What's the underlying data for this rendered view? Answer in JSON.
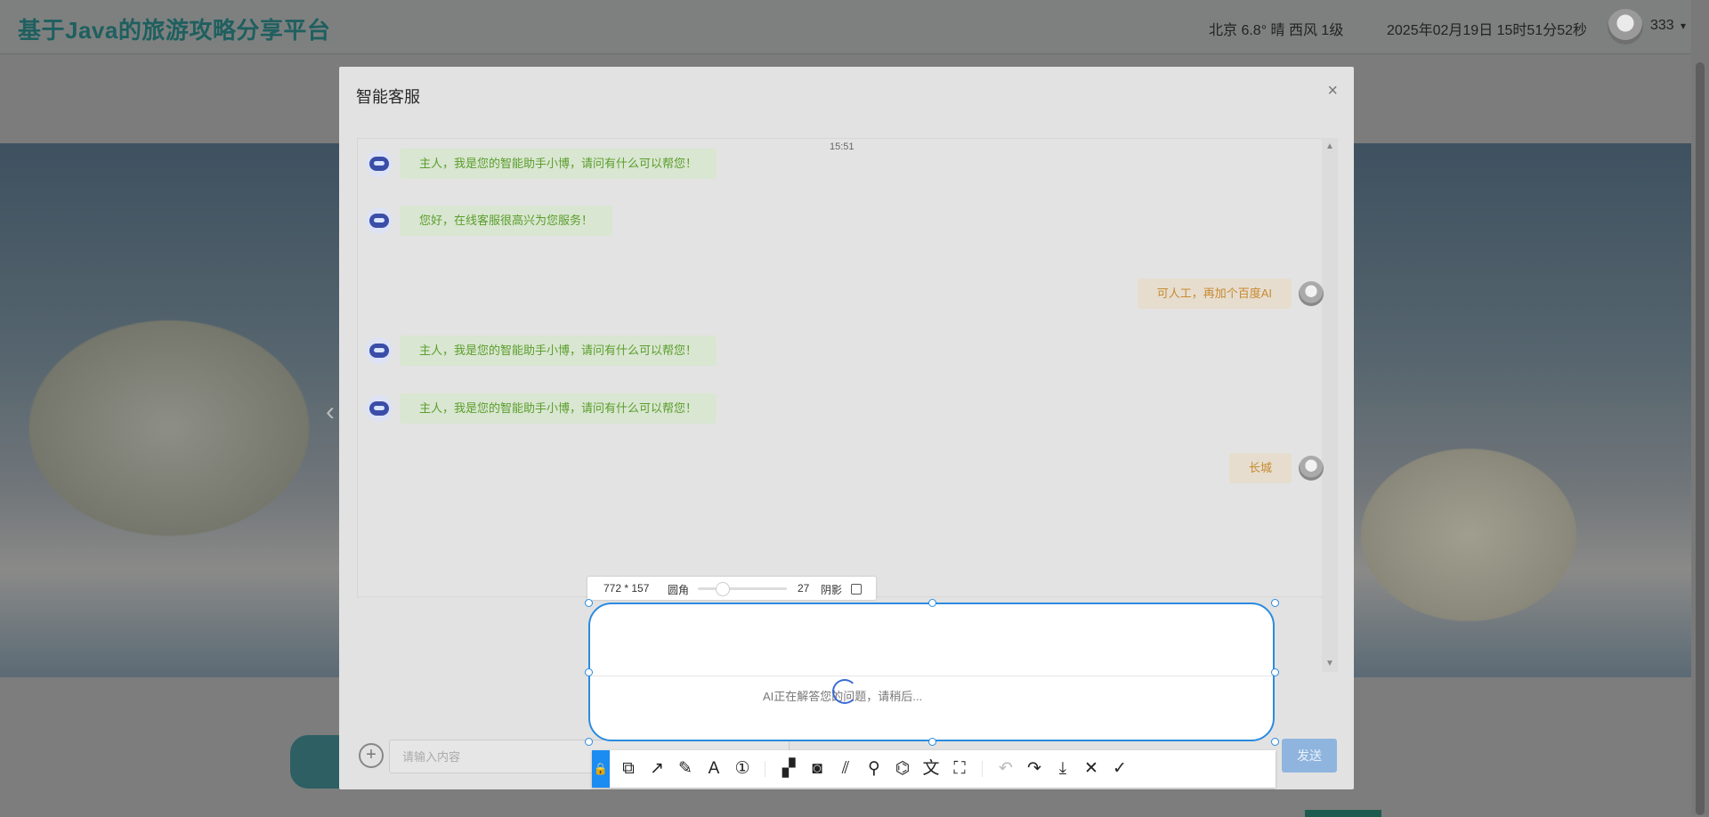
{
  "header": {
    "site_title": "基于Java的旅游攻略分享平台",
    "weather": "北京  6.8°  晴  西风  1级",
    "datetime": "2025年02月19日 15时51分52秒",
    "username": "333",
    "caret": "▾"
  },
  "modal": {
    "title": "智能客服",
    "close": "×",
    "timestamp": "15:51",
    "messages": [
      {
        "from": "bot",
        "text": "主人，我是您的智能助手小博，请问有什么可以帮您！"
      },
      {
        "from": "bot",
        "text": "您好，在线客服很高兴为您服务！"
      },
      {
        "from": "user",
        "text": "可人工，再加个百度AI"
      },
      {
        "from": "bot",
        "text": "主人，我是您的智能助手小博，请问有什么可以帮您！"
      },
      {
        "from": "bot",
        "text": "主人，我是您的智能助手小博，请问有什么可以帮您！"
      },
      {
        "from": "user",
        "text": "长城"
      }
    ],
    "input_placeholder": "请输入内容",
    "send_label": "发送",
    "plus": "+"
  },
  "capture": {
    "dimensions": "772 * 157",
    "corner_label": "圆角",
    "corner_radius": "27",
    "shadow_label": "阴影",
    "status_text": "AI正在解答您的问题，请稍后...",
    "toolbar": [
      {
        "name": "shape-icon",
        "glyph": "⧉"
      },
      {
        "name": "arrow-icon",
        "glyph": "↗"
      },
      {
        "name": "pen-icon",
        "glyph": "✎"
      },
      {
        "name": "text-icon",
        "glyph": "A"
      },
      {
        "name": "number-icon",
        "glyph": "①"
      },
      {
        "name": "mosaic-icon",
        "glyph": "▞"
      },
      {
        "name": "blur-icon",
        "glyph": "◙"
      },
      {
        "name": "hatch-icon",
        "glyph": "⫽"
      },
      {
        "name": "pin-icon",
        "glyph": "⚲"
      },
      {
        "name": "ocr-icon",
        "glyph": "⌬"
      },
      {
        "name": "translate-icon",
        "glyph": "文"
      },
      {
        "name": "scan-text-icon",
        "glyph": "⛶"
      },
      {
        "name": "undo-icon",
        "glyph": "↶"
      },
      {
        "name": "redo-icon",
        "glyph": "↷"
      },
      {
        "name": "download-icon",
        "glyph": "⤓"
      },
      {
        "name": "cancel-icon",
        "glyph": "✕"
      },
      {
        "name": "confirm-icon",
        "glyph": "✓"
      }
    ]
  },
  "colors": {
    "brand": "#1f5f5f",
    "accent": "#2b8be0",
    "bot_text": "#5a9e2c",
    "user_text": "#c88a2e"
  }
}
